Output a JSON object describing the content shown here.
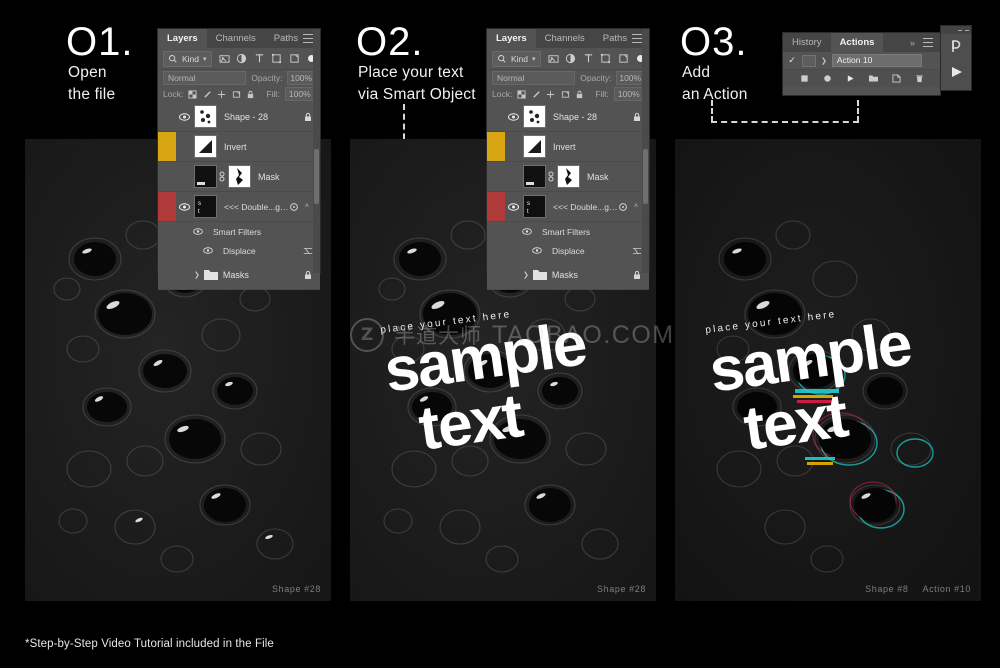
{
  "page": {
    "background": "#000000",
    "footnote": "*Step-by-Step Video Tutorial included in the File"
  },
  "steps": [
    {
      "number": "O1.",
      "title": "Open\nthe file",
      "artwork_labels": {
        "shape": "Shape #28",
        "action": ""
      }
    },
    {
      "number": "O2.",
      "title": "Place your text\nvia Smart Object",
      "artwork_labels": {
        "shape": "Shape #28",
        "action": ""
      }
    },
    {
      "number": "O3.",
      "title": "Add\nan Action",
      "artwork_labels": {
        "shape": "Shape #8",
        "action": "Action #10"
      }
    }
  ],
  "artwork": {
    "tagline": "place your text here",
    "headline_line1": "sample",
    "headline_line2": "text"
  },
  "layers_panel": {
    "tabs": [
      {
        "label": "Layers",
        "active": true
      },
      {
        "label": "Channels",
        "active": false
      },
      {
        "label": "Paths",
        "active": false
      }
    ],
    "menu_icon": "hamburger-menu-icon",
    "filter": {
      "search_icon": "search-icon",
      "kind_label": "Kind",
      "chevron": "chevron-down-icon",
      "type_filters": [
        "pixel-layer-filter-icon",
        "adjustment-layer-filter-icon",
        "type-layer-filter-icon",
        "shape-layer-filter-icon",
        "smart-object-filter-icon"
      ],
      "toggle_icon": "filter-enable-toggle"
    },
    "blend": {
      "mode_label": "Normal",
      "opacity_label": "Opacity:",
      "opacity_value": "100%"
    },
    "lock": {
      "label": "Lock:",
      "icons": [
        "lock-transparent-pixels-icon",
        "lock-image-pixels-icon",
        "lock-position-icon",
        "lock-artboard-nesting-icon",
        "lock-all-icon"
      ],
      "fill_label": "Fill:",
      "fill_value": "100%"
    },
    "layers": [
      {
        "name": "Shape - 28",
        "visible": true,
        "swatch": "#535353",
        "locked": true,
        "thumb": "shape-thumbnail",
        "indent": 0
      },
      {
        "name": "Invert",
        "visible": false,
        "swatch": "#d8a613",
        "locked": false,
        "thumb": "invert-adjustment-thumbnail",
        "indent": 0
      },
      {
        "name": "Mask",
        "visible": false,
        "swatch": "#535353",
        "locked": false,
        "thumb": "mask-thumbnail",
        "indent": 0
      },
      {
        "name": "<<< Double...ge the text",
        "visible": true,
        "swatch": "#b03a3a",
        "locked": false,
        "thumb": "smart-object-thumbnail",
        "indent": 0,
        "smart_object": true
      },
      {
        "name": "Smart Filters",
        "visible": true,
        "swatch": "#535353",
        "locked": false,
        "indent": 1
      },
      {
        "name": "Displace",
        "visible": true,
        "swatch": "#535353",
        "locked": false,
        "indent": 2
      },
      {
        "name": "Masks",
        "visible": false,
        "swatch": "#535353",
        "locked": true,
        "thumb": "folder-icon",
        "indent": 0
      }
    ]
  },
  "actions_panel": {
    "tabs": [
      {
        "label": "History",
        "active": false
      },
      {
        "label": "Actions",
        "active": true
      }
    ],
    "collapse_icon": "collapse-panel-icon",
    "menu_icon": "hamburger-menu-icon",
    "action": {
      "checked": true,
      "expand_icon": "disclosure-triangle-icon",
      "name": "Action 10"
    },
    "toolbar_icons": [
      "stop-icon",
      "record-icon",
      "play-icon",
      "new-set-icon",
      "new-action-icon",
      "delete-icon"
    ]
  },
  "float_panel": {
    "buttons": [
      "record-toggle-icon",
      "play-icon"
    ],
    "titlebar_icons": [
      "minimize-icon",
      "close-icon"
    ]
  },
  "watermark": {
    "logo": "Z",
    "cn_text": "半道大师",
    "site": "TAOBAO.COM"
  }
}
